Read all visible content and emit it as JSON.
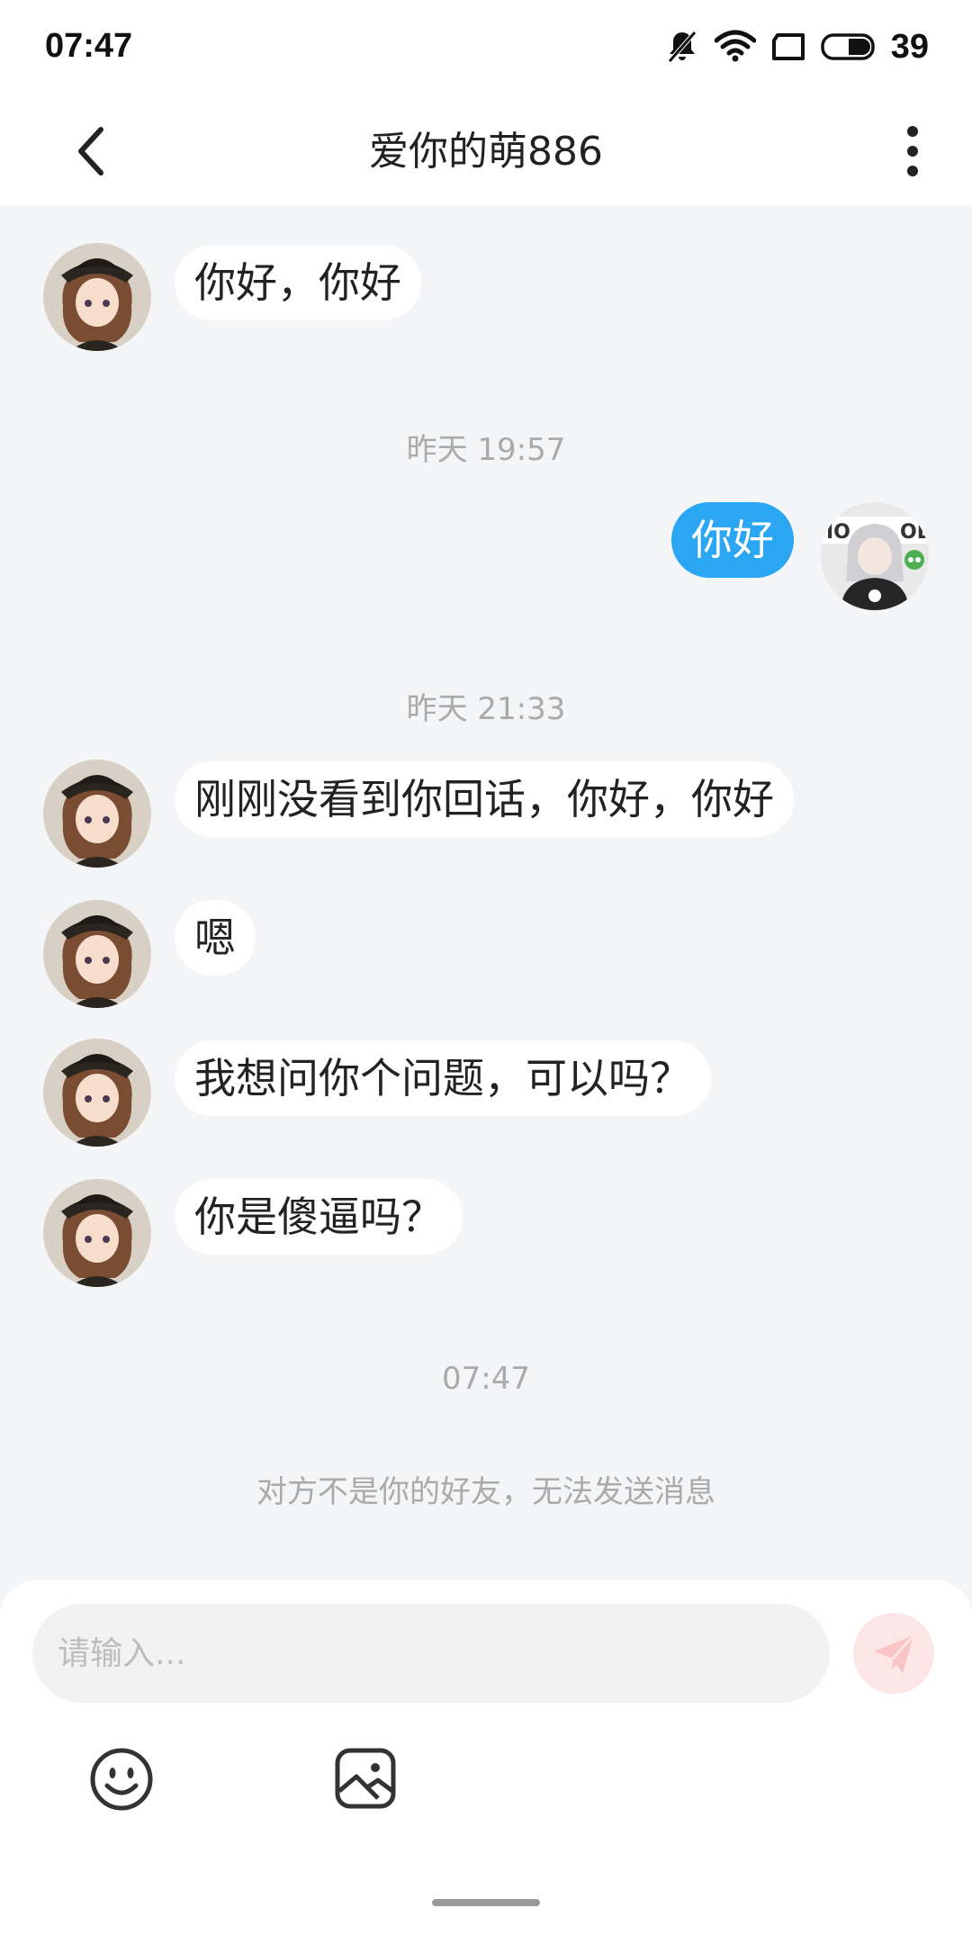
{
  "status_bar": {
    "time": "07:47",
    "battery_level": "39",
    "icons": [
      "mute-bell-icon",
      "wifi-icon",
      "screen-icon",
      "battery-icon"
    ]
  },
  "header": {
    "title": "爱你的萌886",
    "back_icon": "chevron-left-icon",
    "more_icon": "more-vertical-icon"
  },
  "messages": [
    {
      "type": "received",
      "text": "你好，你好"
    },
    {
      "type": "time",
      "text": "昨天 19:57"
    },
    {
      "type": "sent",
      "text": "你好"
    },
    {
      "type": "time",
      "text": "昨天 21:33"
    },
    {
      "type": "received",
      "text": "刚刚没看到你回话，你好，你好"
    },
    {
      "type": "received",
      "text": "嗯"
    },
    {
      "type": "received",
      "text": "我想问你个问题，可以吗？"
    },
    {
      "type": "received",
      "text": "你是傻逼吗？"
    },
    {
      "type": "time",
      "text": "07:47"
    }
  ],
  "notice": "对方不是你的好友，无法发送消息",
  "input": {
    "placeholder": "请输入...",
    "value": ""
  },
  "toolbar": {
    "send_icon": "send-icon",
    "emoji_icon": "emoji-icon",
    "image_icon": "image-icon"
  },
  "colors": {
    "sent_bubble": "#2aa6f2",
    "background": "#f4f5f7",
    "send_button": "#fde6e6"
  }
}
